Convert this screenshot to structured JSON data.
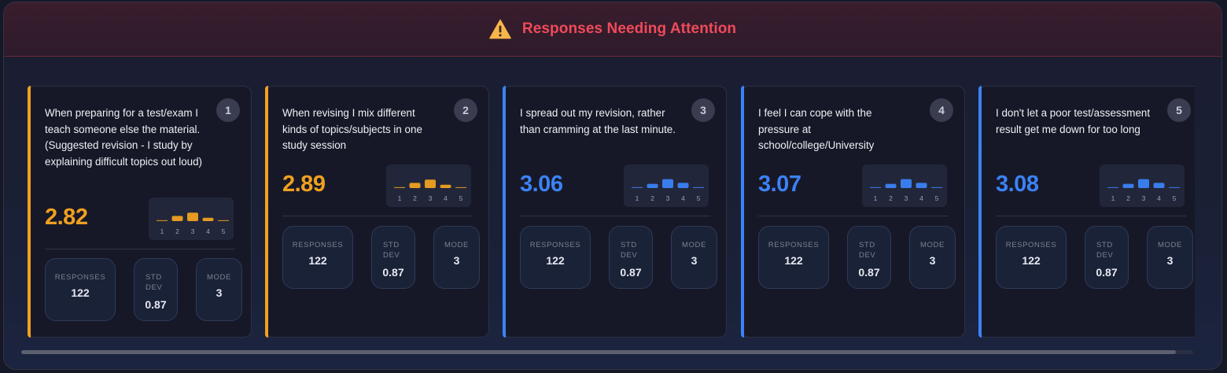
{
  "header": {
    "title": "Responses Needing Attention",
    "icon": "warning-icon"
  },
  "colors": {
    "orange": "#f0a020",
    "blue": "#3b82f6"
  },
  "chart_x_labels": [
    "1",
    "2",
    "3",
    "4",
    "5"
  ],
  "stat_labels": {
    "responses": "RESPONSES",
    "std_dev": "STD DEV",
    "mode": "MODE"
  },
  "cards": [
    {
      "number": "1",
      "question": "When preparing for a test/exam I teach someone else the material. (Suggested revision - I study by explaining difficult topics out loud)",
      "score": "2.82",
      "level": "orange",
      "distribution": [
        0.06,
        0.55,
        0.9,
        0.35,
        0.05
      ],
      "responses": "122",
      "std_dev": "0.87",
      "mode": "3"
    },
    {
      "number": "2",
      "question": "When revising I mix different kinds of topics/subjects in one study session",
      "score": "2.89",
      "level": "orange",
      "distribution": [
        0.06,
        0.55,
        0.9,
        0.35,
        0.05
      ],
      "responses": "122",
      "std_dev": "0.87",
      "mode": "3"
    },
    {
      "number": "3",
      "question": "I spread out my revision, rather than cramming at the last minute.",
      "score": "3.06",
      "level": "blue",
      "distribution": [
        0.05,
        0.45,
        0.95,
        0.55,
        0.08
      ],
      "responses": "122",
      "std_dev": "0.87",
      "mode": "3"
    },
    {
      "number": "4",
      "question": "I feel I can cope with the pressure at school/college/University",
      "score": "3.07",
      "level": "blue",
      "distribution": [
        0.05,
        0.45,
        0.95,
        0.55,
        0.08
      ],
      "responses": "122",
      "std_dev": "0.87",
      "mode": "3"
    },
    {
      "number": "5",
      "question": "I don't let a poor test/assessment result get me down for too long",
      "score": "3.08",
      "level": "blue",
      "distribution": [
        0.05,
        0.45,
        0.95,
        0.55,
        0.08
      ],
      "responses": "122",
      "std_dev": "0.87",
      "mode": "3"
    }
  ]
}
